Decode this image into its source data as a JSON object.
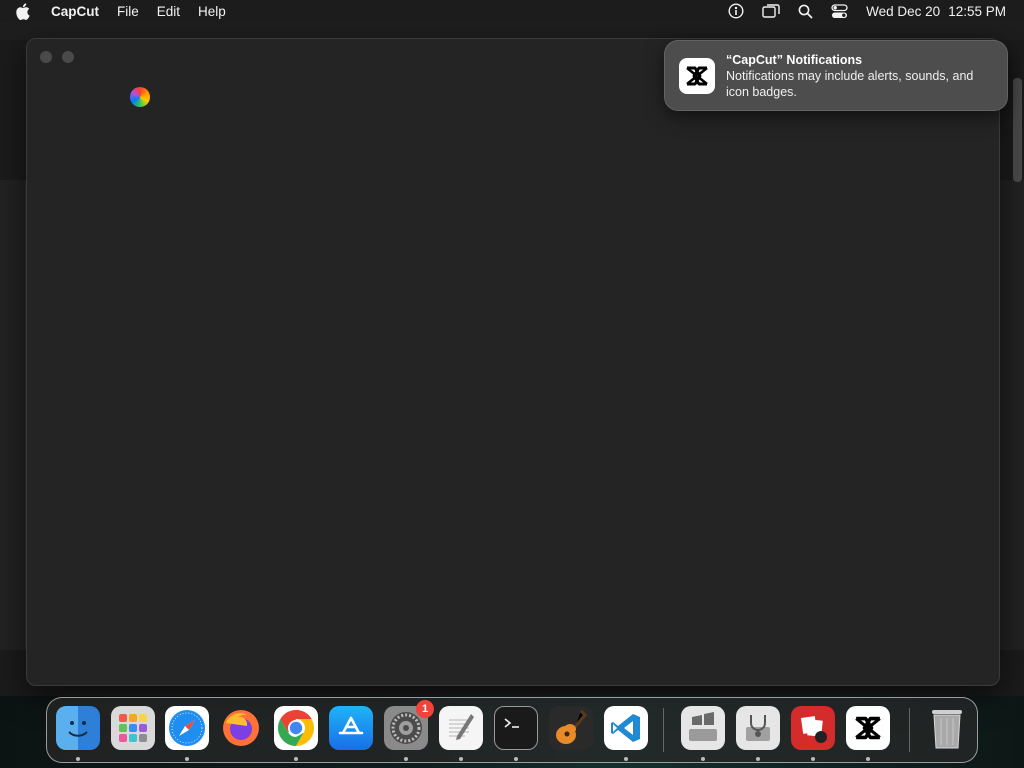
{
  "menubar": {
    "app_name": "CapCut",
    "items": [
      "File",
      "Edit",
      "Help"
    ],
    "date": "Wed Dec 20",
    "time": "12:55 PM"
  },
  "notification": {
    "title": "“CapCut” Notifications",
    "body": "Notifications may include alerts, sounds, and icon badges.",
    "icon": "capcut-icon"
  },
  "dock": {
    "apps": [
      {
        "name": "Finder",
        "icon": "finder-icon"
      },
      {
        "name": "Launchpad",
        "icon": "launchpad-icon"
      },
      {
        "name": "Safari",
        "icon": "safari-icon"
      },
      {
        "name": "Firefox",
        "icon": "firefox-icon"
      },
      {
        "name": "Google Chrome",
        "icon": "chrome-icon"
      },
      {
        "name": "App Store",
        "icon": "app-store-icon"
      },
      {
        "name": "System Settings",
        "icon": "settings-icon",
        "badge": "1"
      },
      {
        "name": "TextEdit",
        "icon": "textedit-icon"
      },
      {
        "name": "Terminal",
        "icon": "terminal-icon"
      },
      {
        "name": "GarageBand",
        "icon": "garageband-icon"
      },
      {
        "name": "Visual Studio Code",
        "icon": "vscode-icon"
      },
      {
        "name": "Boot Camp Assistant",
        "icon": "bootcamp-icon"
      },
      {
        "name": "Disk Utility",
        "icon": "disk-utility-icon"
      },
      {
        "name": "Photo Booth",
        "icon": "photo-booth-icon"
      },
      {
        "name": "CapCut",
        "icon": "capcut-icon"
      },
      {
        "name": "Trash",
        "icon": "trash-icon"
      }
    ]
  }
}
